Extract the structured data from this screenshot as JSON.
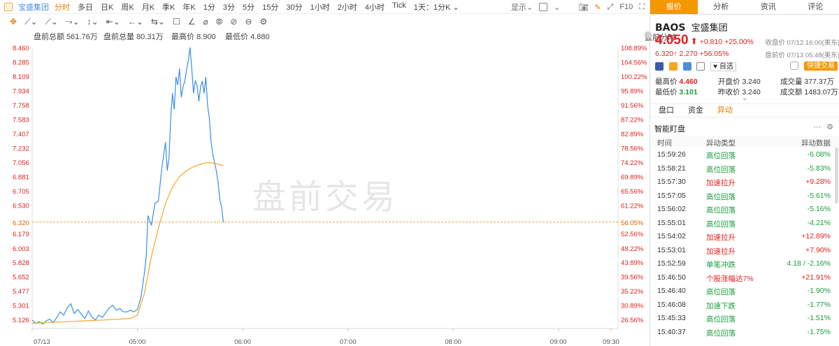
{
  "topbar": {
    "stock_name": "宝盛集团",
    "periods": [
      "分时",
      "多日",
      "日K",
      "周K",
      "月K",
      "季K",
      "年K",
      "1分",
      "3分",
      "5分",
      "15分",
      "30分",
      "1小时",
      "2小时",
      "4小时",
      "Tick",
      "1天：1分K ⌄"
    ],
    "active_period": "分时",
    "display_label": "显示⌄",
    "f10_label": "F10"
  },
  "toolbar2": {
    "icons": [
      "move-icon",
      "line-icon",
      "polyline-icon",
      "wave-icon",
      "segment-icon",
      "arrow-icon",
      "parallel-icon",
      "circle-icon",
      "comment-icon",
      "edit-icon",
      "magnet-icon",
      "eye-icon",
      "delete-icon",
      "lock-icon",
      "settings-icon"
    ],
    "glyphs": [
      "✥",
      "⟋⌄",
      "⟋⌄",
      "⤳⌄",
      "↕⌄",
      "⇤⌄",
      "←⌄",
      "⇆⌄",
      "☐",
      "∠",
      "⌀",
      "⦾",
      "⊘",
      "⊖",
      "⚙"
    ]
  },
  "infobar": {
    "pre_amount_label": "盘前总额",
    "pre_amount": "561.76万",
    "pre_vol_label": "盘前总量",
    "pre_vol": "80.31万",
    "high_label": "最高价",
    "high": "8.900",
    "low_label": "最低价",
    "low": "4.880",
    "mode": "盘前分时"
  },
  "chart_data": {
    "type": "line",
    "title": "",
    "watermark": "盘前交易",
    "price_ticks": [
      "8.460",
      "8.285",
      "8.109",
      "7.934",
      "7.758",
      "7.583",
      "7.407",
      "7.232",
      "7.056",
      "6.881",
      "6.705",
      "6.530",
      "6.320",
      "6.179",
      "6.003",
      "5.828",
      "5.652",
      "5.477",
      "5.301",
      "5.126"
    ],
    "pct_ticks": [
      "108.89%",
      "104.56%",
      "100.22%",
      "95.89%",
      "91.56%",
      "87.22%",
      "82.89%",
      "78.56%",
      "74.22%",
      "69.89%",
      "65.56%",
      "61.22%",
      "56.05%",
      "52.56%",
      "48.22%",
      "43.89%",
      "39.56%",
      "35.22%",
      "30.89%",
      "26.56%"
    ],
    "ylim": [
      5.05,
      8.46
    ],
    "reference_price": 6.32,
    "reference_price_label": "6.320",
    "reference_pct_label": "56.05%",
    "x_ticks": [
      "07/13",
      "05:00",
      "06:00",
      "07:00",
      "08:00",
      "09:00",
      "09:30"
    ],
    "x_tick_minutes": [
      240,
      300,
      360,
      420,
      480,
      540,
      570
    ],
    "xlim": [
      240,
      574
    ],
    "series": [
      {
        "name": "",
        "color": "#3a8ee6",
        "x": [
          240,
          242,
          244,
          246,
          248,
          250,
          252,
          254,
          256,
          258,
          260,
          262,
          264,
          266,
          268,
          270,
          272,
          274,
          276,
          278,
          280,
          282,
          284,
          286,
          288,
          290,
          292,
          294,
          296,
          298,
          300,
          302,
          304,
          305,
          306,
          308,
          310,
          312,
          313,
          314,
          316,
          317,
          318,
          319,
          320,
          321,
          322,
          323,
          324,
          325,
          326,
          327,
          328,
          329,
          330,
          331,
          332,
          333,
          334,
          335,
          336,
          337,
          338,
          339,
          340,
          341,
          342,
          343,
          344,
          345,
          346,
          347,
          348,
          349
        ],
        "values": [
          5.12,
          5.08,
          5.1,
          5.07,
          5.11,
          5.13,
          5.09,
          5.15,
          5.22,
          5.18,
          5.27,
          5.32,
          5.2,
          5.25,
          5.19,
          5.14,
          5.23,
          5.16,
          5.12,
          5.18,
          5.15,
          5.21,
          5.27,
          5.3,
          5.24,
          5.26,
          5.22,
          5.22,
          5.24,
          5.22,
          5.25,
          5.4,
          5.7,
          5.9,
          6.4,
          6.28,
          6.55,
          6.58,
          6.8,
          7.0,
          7.3,
          6.95,
          7.1,
          7.6,
          7.9,
          7.7,
          8.1,
          8.0,
          8.2,
          7.85,
          7.98,
          8.05,
          8.18,
          8.3,
          8.46,
          8.2,
          7.9,
          8.05,
          8.0,
          7.8,
          7.98,
          8.05,
          7.9,
          8.1,
          7.75,
          7.6,
          7.3,
          7.15,
          7.05,
          6.95,
          6.8,
          6.6,
          6.5,
          6.32
        ]
      },
      {
        "name": "",
        "color": "#f5a623",
        "x": [
          240,
          250,
          260,
          270,
          280,
          290,
          296,
          300,
          304,
          308,
          312,
          316,
          320,
          324,
          328,
          332,
          336,
          340,
          344,
          348,
          349
        ],
        "values": [
          5.08,
          5.09,
          5.1,
          5.11,
          5.12,
          5.13,
          5.14,
          5.18,
          5.45,
          5.9,
          6.25,
          6.55,
          6.75,
          6.88,
          6.95,
          7.0,
          7.03,
          7.05,
          7.04,
          7.02,
          7.01
        ]
      }
    ]
  },
  "right": {
    "tabs": [
      "报价",
      "分析",
      "资讯",
      "评论"
    ],
    "active_tab": "报价",
    "code": "BAOS",
    "name": "宝盛集团",
    "price": "4.050",
    "arrow": "⬆",
    "change": "+0.810",
    "change_pct": "+25.00%",
    "close_time": "收盘价 07/12 16:00(美东)",
    "pre_price": "6.320",
    "pre_change": "2.270",
    "pre_pct": "+56.05%",
    "pre_time": "盘前价 07/13 05:48(美东)",
    "watchlist_label": "♥ 自选",
    "quick_trade": "快捷交易",
    "stats": {
      "high_label": "最高价",
      "high": "4.460",
      "open_label": "开盘价",
      "open": "3.240",
      "volume_label": "成交量",
      "volume": "377.37万",
      "low_label": "最低价",
      "low": "3.101",
      "prev_close_label": "昨收价",
      "prev_close": "3.240",
      "amount_label": "成交额",
      "amount": "1483.07万"
    },
    "subtabs": [
      "盘口",
      "资金",
      "异动"
    ],
    "active_subtab": "异动",
    "monitor_title": "智能盯盘",
    "monitor_headers": [
      "时间",
      "异动类型",
      "异动数据"
    ],
    "monitor_rows": [
      {
        "time": "15:59:26",
        "type": "高位回落",
        "data": "-6.08%",
        "dir": "down"
      },
      {
        "time": "15:58:21",
        "type": "高位回落",
        "data": "-5.83%",
        "dir": "down"
      },
      {
        "time": "15:57:30",
        "type": "加速拉升",
        "data": "+9.28%",
        "dir": "up"
      },
      {
        "time": "15:57:05",
        "type": "高位回落",
        "data": "-5.61%",
        "dir": "down"
      },
      {
        "time": "15:56:02",
        "type": "高位回落",
        "data": "-5.16%",
        "dir": "down"
      },
      {
        "time": "15:55:01",
        "type": "高位回落",
        "data": "-4.21%",
        "dir": "down"
      },
      {
        "time": "15:54:02",
        "type": "加速拉升",
        "data": "+12.89%",
        "dir": "up"
      },
      {
        "time": "15:53:01",
        "type": "加速拉升",
        "data": "+7.90%",
        "dir": "up"
      },
      {
        "time": "15:52:59",
        "type": "单笔冲跌",
        "data": "4.18 / -2.16%",
        "dir": "down"
      },
      {
        "time": "15:46:50",
        "type": "个股涨幅达7%",
        "data": "+21.91%",
        "dir": "up"
      },
      {
        "time": "15:46:40",
        "type": "高位回落",
        "data": "-1.90%",
        "dir": "down"
      },
      {
        "time": "15:46:08",
        "type": "加速下跌",
        "data": "-1.77%",
        "dir": "down"
      },
      {
        "time": "15:45:33",
        "type": "高位回落",
        "data": "-1.51%",
        "dir": "down"
      },
      {
        "time": "15:40:37",
        "type": "高位回落",
        "data": "-1.75%",
        "dir": "down"
      }
    ]
  }
}
